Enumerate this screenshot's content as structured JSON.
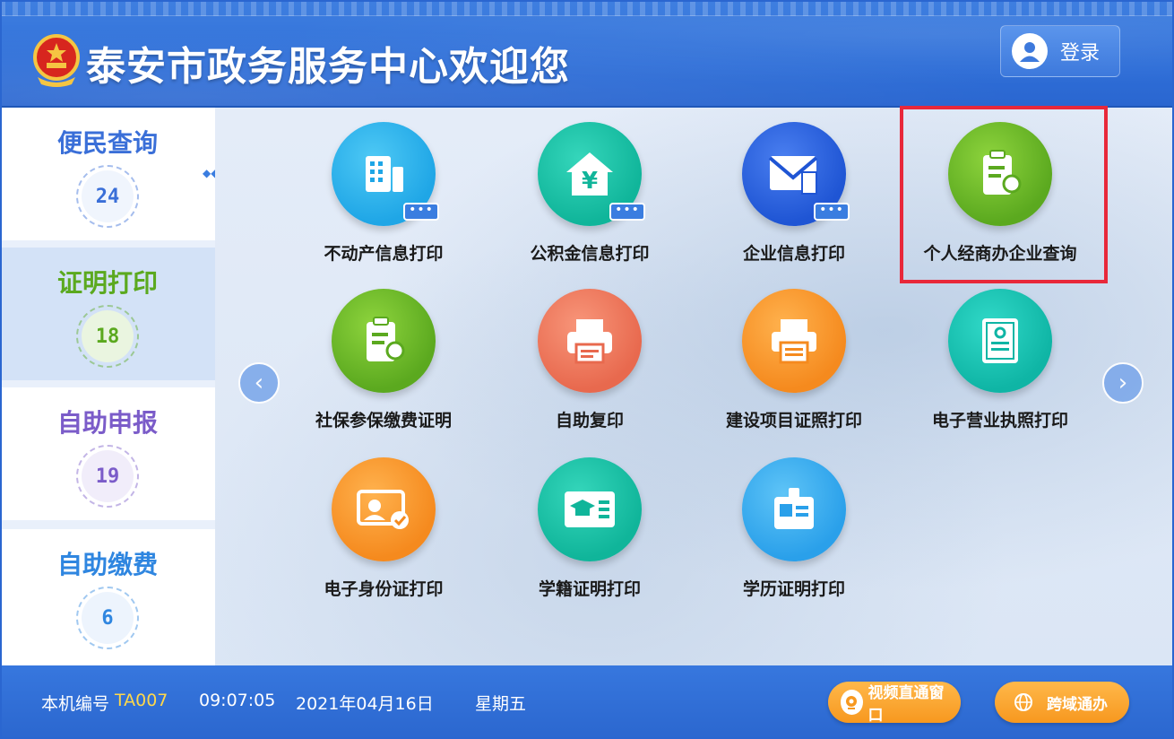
{
  "header": {
    "title": "泰安市政务服务中心欢迎您",
    "login_label": "登录"
  },
  "sidebar": {
    "items": [
      {
        "label": "便民查询",
        "count": "24",
        "color": "#3a6fd8"
      },
      {
        "label": "证明打印",
        "count": "18",
        "color": "#5ba91f",
        "active": true
      },
      {
        "label": "自助申报",
        "count": "19",
        "color": "#7b5cc9"
      },
      {
        "label": "自助缴费",
        "count": "6",
        "color": "#2f86e0"
      }
    ]
  },
  "services": [
    {
      "label": "不动产信息打印",
      "icon": "building-icon",
      "color": "#1fa6e6",
      "has_more": true
    },
    {
      "label": "公积金信息打印",
      "icon": "yuan-house-icon",
      "color": "#10b59a",
      "has_more": true
    },
    {
      "label": "企业信息打印",
      "icon": "mail-building-icon",
      "color": "#1f55d4",
      "has_more": true
    },
    {
      "label": "个人经商办企业查询",
      "icon": "certificate-clipboard-icon",
      "color": "#5ba91f",
      "highlighted": true
    },
    {
      "label": "社保参保缴费证明",
      "icon": "certificate-clipboard-icon",
      "color": "#5ba91f"
    },
    {
      "label": "自助复印",
      "icon": "printer-icon",
      "color": "#e8694e"
    },
    {
      "label": "建设项目证照打印",
      "icon": "printer-icon",
      "color": "#f58a1e"
    },
    {
      "label": "电子营业执照打印",
      "icon": "license-icon",
      "color": "#0fb5a5"
    },
    {
      "label": "电子身份证打印",
      "icon": "id-card-icon",
      "color": "#f58a1e"
    },
    {
      "label": "学籍证明打印",
      "icon": "graduation-card-icon",
      "color": "#10b59a"
    },
    {
      "label": "学历证明打印",
      "icon": "badge-card-icon",
      "color": "#2aa0ea"
    }
  ],
  "footer": {
    "machine_label": "本机编号",
    "machine_id": "TA007",
    "time": "09:07:05",
    "date": "2021年04月16日",
    "weekday": "星期五",
    "video_button": "视频直通窗口",
    "cross_region_button": "跨域通办"
  }
}
